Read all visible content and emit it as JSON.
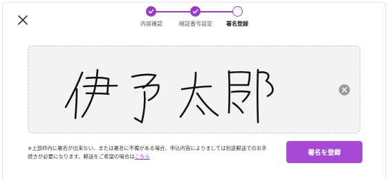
{
  "icons": {
    "close": "close-icon",
    "step_done": "check-icon",
    "clear": "clear-x-icon"
  },
  "stepper": {
    "steps": [
      {
        "label": "内容確認",
        "state": "done"
      },
      {
        "label": "暗証番号設定",
        "state": "done"
      },
      {
        "label": "署名登録",
        "state": "current"
      }
    ]
  },
  "signature": {
    "handwritten_text": "伊予太郎"
  },
  "notice": {
    "text": "※上部枠内に署名が出来ない、または署名に不備がある場合、申込内容によりましては別途郵送でのお手続きが必要になります。郵送をご希望の場合は",
    "link_label": "こちら"
  },
  "actions": {
    "register_label": "署名を登録"
  },
  "colors": {
    "accent": "#9a3bc9",
    "button": "#a748d6",
    "sign_area_bg": "#f3f3f3"
  }
}
